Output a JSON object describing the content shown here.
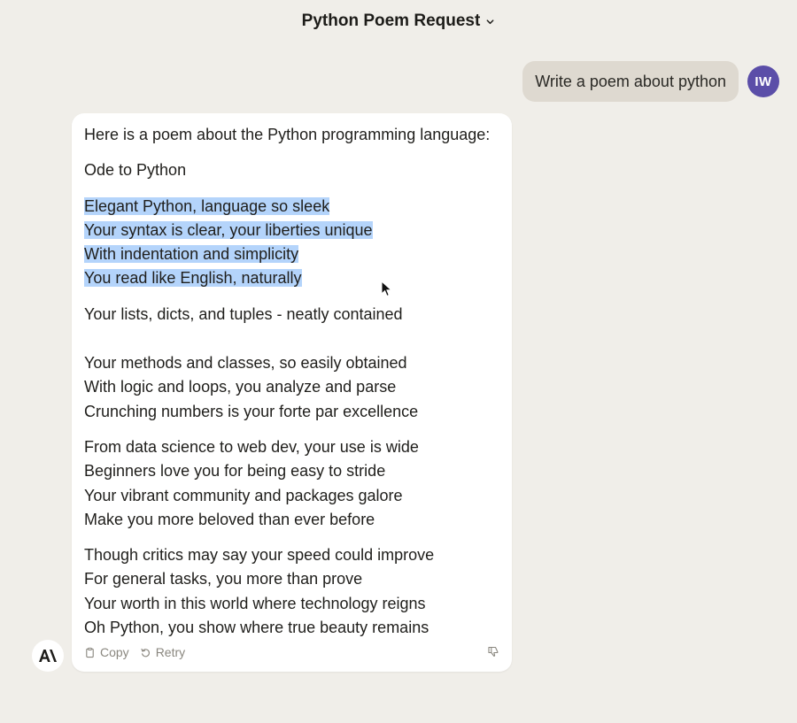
{
  "header": {
    "title": "Python Poem Request",
    "dropdown_icon": "chevron-down-icon"
  },
  "user_message": {
    "text": "Write a poem about python",
    "avatar_initials": "IW",
    "avatar_color": "#5b4ea8"
  },
  "assistant_message": {
    "intro": "Here is a poem about the Python programming language:",
    "poem_title": "Ode to Python",
    "stanza1": [
      "Elegant Python, language so sleek",
      "Your syntax is clear, your liberties unique",
      "With indentation and simplicity",
      "You read like English, naturally"
    ],
    "stanza2": [
      "Your lists, dicts, and tuples - neatly contained"
    ],
    "stanza3": [
      "Your methods and classes, so easily obtained",
      "With logic and loops, you analyze and parse",
      "Crunching numbers is your forte par excellence"
    ],
    "stanza4": [
      "From data science to web dev, your use is wide",
      "Beginners love you for being easy to stride",
      "Your vibrant community and packages galore",
      "Make you more beloved than ever before"
    ],
    "stanza5": [
      "Though critics may say your speed could improve",
      "For general tasks, you more than prove",
      "Your worth in this world where technology reigns",
      "Oh Python, you show where true beauty remains"
    ]
  },
  "actions": {
    "copy_label": "Copy",
    "retry_label": "Retry"
  },
  "colors": {
    "background": "#f0eee9",
    "user_bubble": "#ded9d0",
    "selection": "#b4d4fb"
  }
}
